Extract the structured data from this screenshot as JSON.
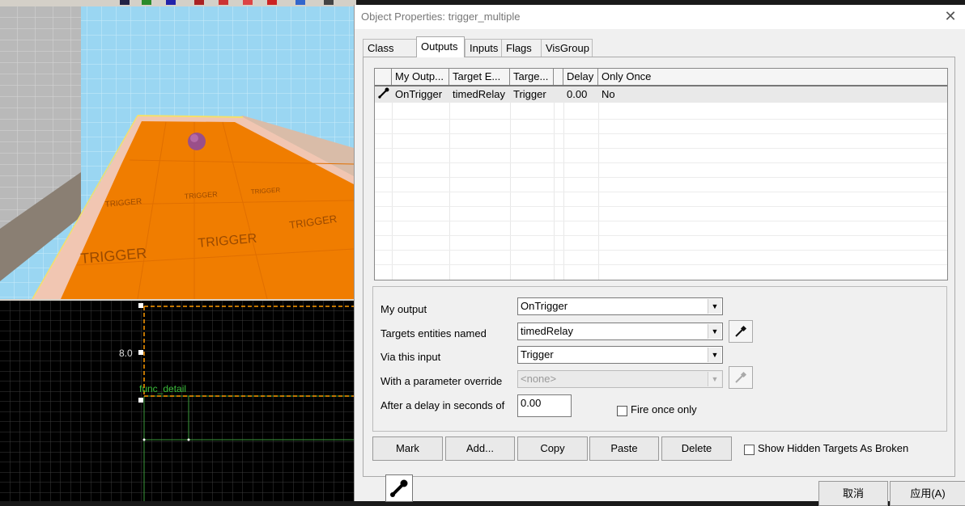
{
  "editor": {
    "view2d_label_size": "8.0",
    "view2d_entity_label": "func_detail",
    "texture_word": "TRIGGER"
  },
  "dialog": {
    "title": "Object Properties: trigger_multiple",
    "close_glyph": "✕",
    "tabs": [
      {
        "label": "Class Info"
      },
      {
        "label": "Outputs"
      },
      {
        "label": "Inputs"
      },
      {
        "label": "Flags"
      },
      {
        "label": "VisGroup"
      }
    ],
    "active_tab": "Outputs",
    "outputs_table": {
      "columns": [
        "",
        "My Outp...",
        "Target E...",
        "Targe...",
        "",
        "Delay",
        "Only Once"
      ],
      "rows": [
        {
          "icon": "output-connection-icon",
          "my_output": "OnTrigger",
          "target_entity": "timedRelay",
          "target_input": "Trigger",
          "delay": "0.00",
          "only_once": "No"
        }
      ]
    },
    "form": {
      "my_output_label": "My output",
      "my_output_value": "OnTrigger",
      "targets_label": "Targets entities named",
      "targets_value": "timedRelay",
      "via_input_label": "Via this input",
      "via_input_value": "Trigger",
      "param_label": "With a parameter override",
      "param_value": "<none>",
      "delay_label": "After a delay in seconds of",
      "delay_value": "0.00",
      "fire_once_label": "Fire once only"
    },
    "buttons": {
      "mark": "Mark",
      "add": "Add...",
      "copy": "Copy",
      "paste": "Paste",
      "delete": "Delete"
    },
    "show_hidden_label": "Show Hidden Targets As Broken",
    "bottom_buttons": {
      "cancel": "取消",
      "apply": "应用(A)"
    }
  }
}
